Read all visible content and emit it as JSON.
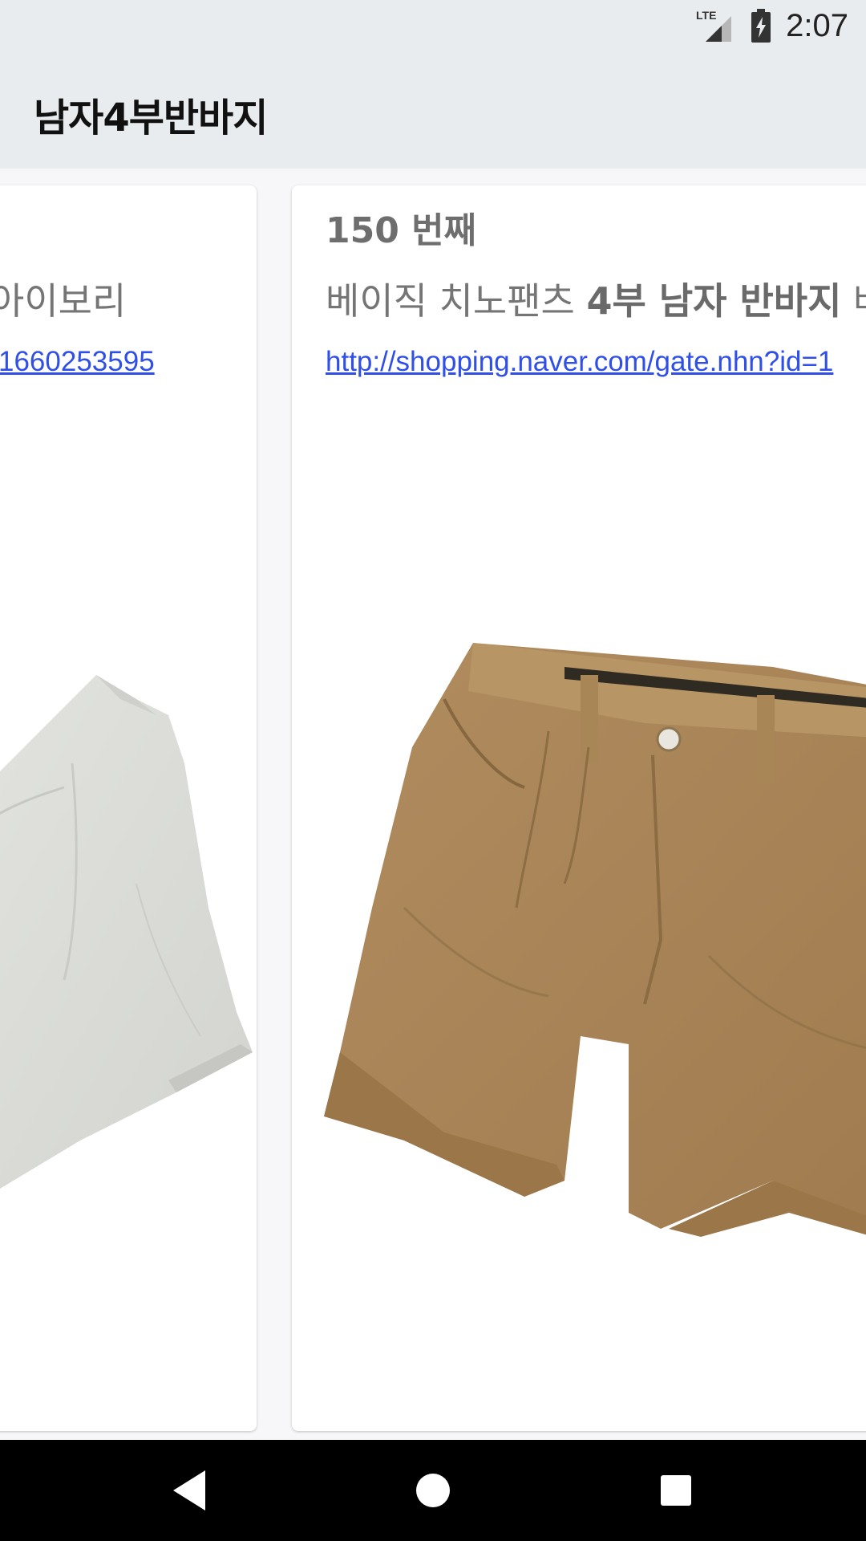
{
  "status_bar": {
    "network_label": "LTE",
    "time": "2:07"
  },
  "app_bar": {
    "title": "남자4부반바지"
  },
  "cards": [
    {
      "title_fragment": "아이보리",
      "link_fragment": "1660253595",
      "image_icon": "shorts-image-white"
    },
    {
      "rank": "150 번째",
      "title_plain": "베이직 치노팬츠 ",
      "title_bold": "4부 남자 반바지",
      "title_tail": " 베",
      "link": "http://shopping.naver.com/gate.nhn?id=1",
      "image_icon": "shorts-image-beige"
    }
  ],
  "nav_bar": {
    "back_icon": "back-triangle-icon",
    "home_icon": "home-circle-icon",
    "recents_icon": "recents-square-icon"
  },
  "colors": {
    "app_bar_bg": "#e9ecef",
    "link": "#2f4fe8",
    "nav_bg": "#000000"
  }
}
